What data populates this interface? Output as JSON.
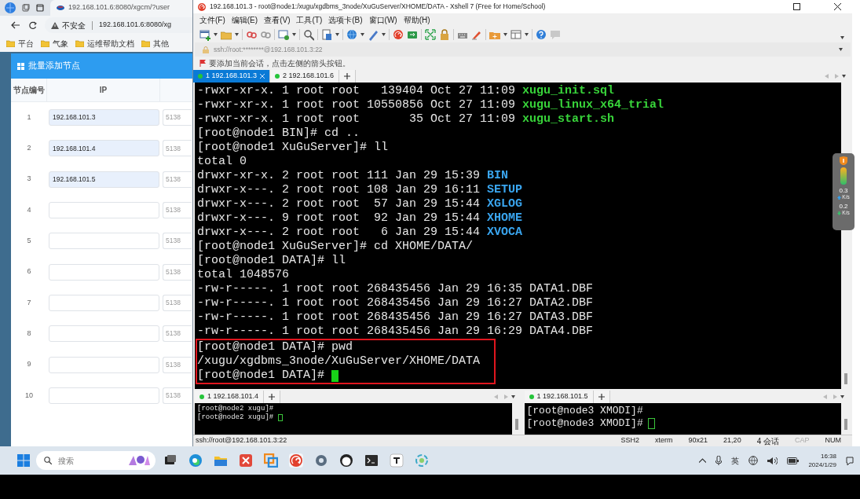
{
  "browser": {
    "tab_title": "192.168.101.6:8080/xgcm/?user",
    "security_label": "不安全",
    "address": "192.168.101.6:8080/xg",
    "bookmarks": [
      {
        "label": "平台"
      },
      {
        "label": "气象"
      },
      {
        "label": "运维帮助文档"
      },
      {
        "label": "其他"
      }
    ],
    "dialog": {
      "title": "批量添加节点",
      "columns": [
        "节点编号",
        "IP"
      ],
      "rows": [
        {
          "number": "1",
          "ip": "192.168.101.3",
          "port": "5138"
        },
        {
          "number": "2",
          "ip": "192.168.101.4",
          "port": "5138"
        },
        {
          "number": "3",
          "ip": "192.168.101.5",
          "port": "5138"
        },
        {
          "number": "4",
          "port": "5138"
        },
        {
          "number": "5",
          "port": "5138"
        },
        {
          "number": "6",
          "port": "5138"
        },
        {
          "number": "7",
          "port": "5138"
        },
        {
          "number": "8",
          "port": "5138"
        },
        {
          "number": "9",
          "port": "5138"
        },
        {
          "number": "10",
          "port": "5138"
        }
      ]
    }
  },
  "xshell": {
    "title": "192.168.101.3 - root@node1:/xugu/xgdbms_3node/XuGuServer/XHOME/DATA - Xshell 7 (Free for Home/School)",
    "menu": [
      "文件(F)",
      "编辑(E)",
      "查看(V)",
      "工具(T)",
      "选项卡(B)",
      "窗口(W)",
      "帮助(H)"
    ],
    "address": "ssh://root:********@192.168.101.3:22",
    "hint": "要添加当前会话，点击左侧的箭头按钮。",
    "tabs": [
      {
        "label": "1 192.168.101.3",
        "selected": true,
        "connected": true
      },
      {
        "label": "2 192.168.101.6",
        "selected": false,
        "connected": true
      }
    ],
    "terminal": {
      "lines": [
        {
          "text": "-rwxr-xr-x. 1 root root   139404 Oct 27 11:09 ",
          "file": "xugu_init.sql",
          "kind": "exe"
        },
        {
          "text": "-rwxr-xr-x. 1 root root 10550856 Oct 27 11:09 ",
          "file": "xugu_linux_x64_trial",
          "kind": "exe"
        },
        {
          "text": "-rwxr-xr-x. 1 root root       35 Oct 27 11:09 ",
          "file": "xugu_start.sh",
          "kind": "exe"
        },
        {
          "text": "[root@node1 BIN]# cd .."
        },
        {
          "text": "[root@node1 XuGuServer]# ll"
        },
        {
          "text": "total 0"
        },
        {
          "text": "drwxr-xr-x. 2 root root 111 Jan 29 15:39 ",
          "file": "BIN",
          "kind": "dir"
        },
        {
          "text": "drwxr-x---. 2 root root 108 Jan 29 16:11 ",
          "file": "SETUP",
          "kind": "dir"
        },
        {
          "text": "drwxr-x---. 2 root root  57 Jan 29 15:44 ",
          "file": "XGLOG",
          "kind": "dir"
        },
        {
          "text": "drwxr-x---. 9 root root  92 Jan 29 15:44 ",
          "file": "XHOME",
          "kind": "dir"
        },
        {
          "text": "drwxr-x---. 2 root root   6 Jan 29 15:44 ",
          "file": "XVOCA",
          "kind": "dir"
        },
        {
          "text": "[root@node1 XuGuServer]# cd XHOME/DATA/"
        },
        {
          "text": "[root@node1 DATA]# ll"
        },
        {
          "text": "total 1048576"
        },
        {
          "text": "-rw-r-----. 1 root root 268435456 Jan 29 16:35 DATA1.DBF"
        },
        {
          "text": "-rw-r-----. 1 root root 268435456 Jan 29 16:27 DATA2.DBF"
        },
        {
          "text": "-rw-r-----. 1 root root 268435456 Jan 29 16:27 DATA3.DBF"
        },
        {
          "text": "-rw-r-----. 1 root root 268435456 Jan 29 16:29 DATA4.DBF"
        },
        {
          "text": "[root@node1 DATA]# pwd",
          "boxed": true
        },
        {
          "text": "/xugu/xgdbms_3node/XuGuServer/XHOME/DATA",
          "boxed": true
        },
        {
          "text": "[root@node1 DATA]#",
          "boxed": true,
          "cursor": true
        }
      ],
      "focused": true
    },
    "panes": [
      {
        "tab": "1 192.168.101.4",
        "connected": true,
        "focused": false,
        "lines": [
          {
            "text": "[root@node2 xugu]#"
          },
          {
            "text": "[root@node2 xugu]#",
            "cursor": true
          }
        ]
      },
      {
        "tab": "1 192.168.101.5",
        "connected": true,
        "focused": false,
        "lines": [
          {
            "text": "[root@node3 XMODI]#"
          },
          {
            "text": "[root@node3 XMODI]#",
            "cursor": true
          }
        ]
      }
    ],
    "status_bar": [
      {
        "text": "ssh://root@192.168.101.3:22",
        "disabled": false
      },
      {
        "text": "SSH2",
        "disabled": false
      },
      {
        "text": "xterm",
        "disabled": false
      },
      {
        "text": "90x21",
        "disabled": false
      },
      {
        "text": "21,20",
        "disabled": false
      },
      {
        "text": "4 会话",
        "disabled": false
      },
      {
        "text": "CAP",
        "disabled": true
      },
      {
        "text": "NUM",
        "disabled": false
      }
    ]
  },
  "net_widget": [
    {
      "kind": "up",
      "value": "0.3",
      "unit": "K/s"
    },
    {
      "kind": "down",
      "value": "0.2",
      "unit": "K/s"
    }
  ],
  "taskbar": {
    "search_placeholder": "搜索",
    "language": "英",
    "time": "16:38",
    "date": "2024/1/29"
  }
}
